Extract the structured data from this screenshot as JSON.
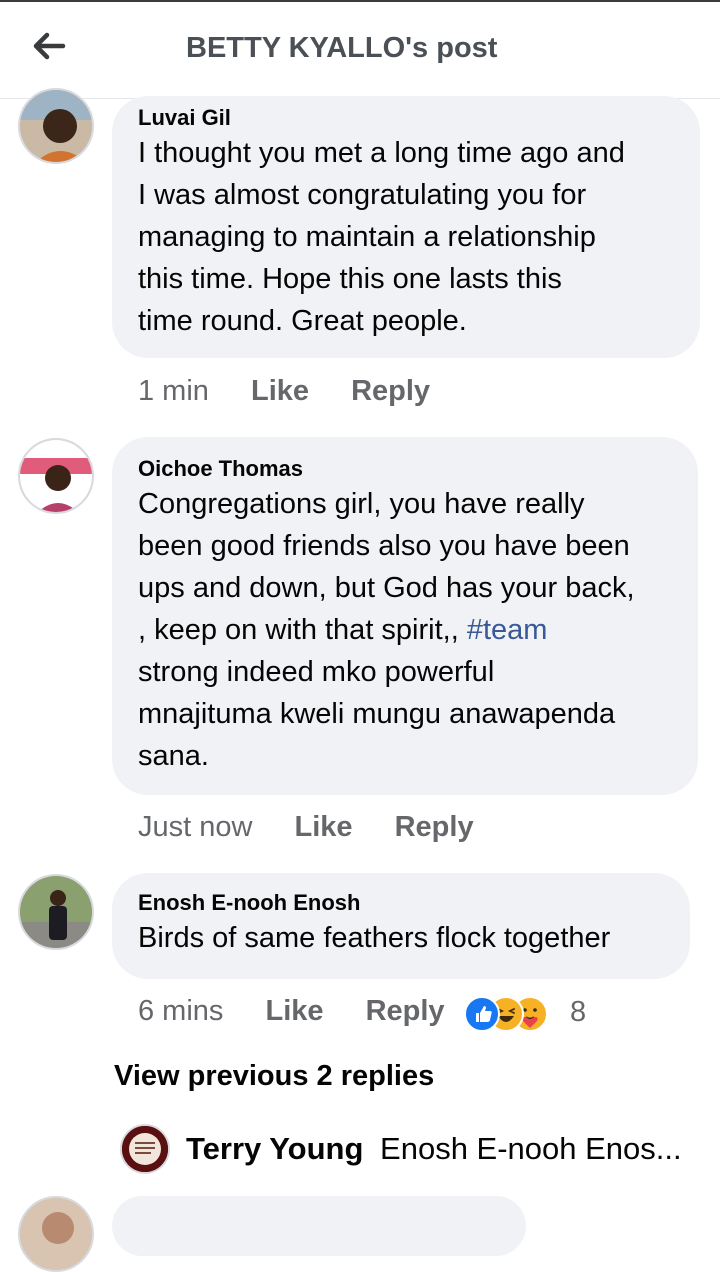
{
  "header": {
    "title": "BETTY KYALLO's post",
    "back_icon": "arrow-left-icon"
  },
  "comments": [
    {
      "author": "Luvai Gil",
      "lines": [
        "I thought you met a long time ago and",
        "I was almost congratulating you for",
        "managing to maintain a relationship",
        "this time. Hope this one lasts this",
        "time round. Great people."
      ],
      "time": "1 min",
      "like_label": "Like",
      "reply_label": "Reply"
    },
    {
      "author": "Oichoe Thomas",
      "lines": [
        "Congregations girl, you have really",
        "been good friends also you have been",
        "ups and down, but God has your back,",
        ", keep on with that spirit,, ",
        "strong indeed mko powerful",
        "mnajituma kweli mungu anawapenda",
        "sana."
      ],
      "hashtag": "#team",
      "time": "Just now",
      "like_label": "Like",
      "reply_label": "Reply"
    },
    {
      "author": "Enosh E-nooh Enosh",
      "lines": [
        "Birds of same feathers flock together"
      ],
      "time": "6 mins",
      "like_label": "Like",
      "reply_label": "Reply",
      "reactions": [
        "like-reaction-icon",
        "haha-reaction-icon",
        "care-reaction-icon"
      ],
      "reaction_count": "8"
    }
  ],
  "replies": {
    "view_previous_label": "View previous 2 replies",
    "preview": {
      "author": "Terry Young",
      "text": "Enosh E-nooh Enos..."
    }
  },
  "colors": {
    "bubble": "#f0f2f5",
    "meta_text": "#65676b",
    "hashtag": "#385898",
    "like_blue": "#1877f2",
    "haha_yellow": "#f7b125"
  }
}
